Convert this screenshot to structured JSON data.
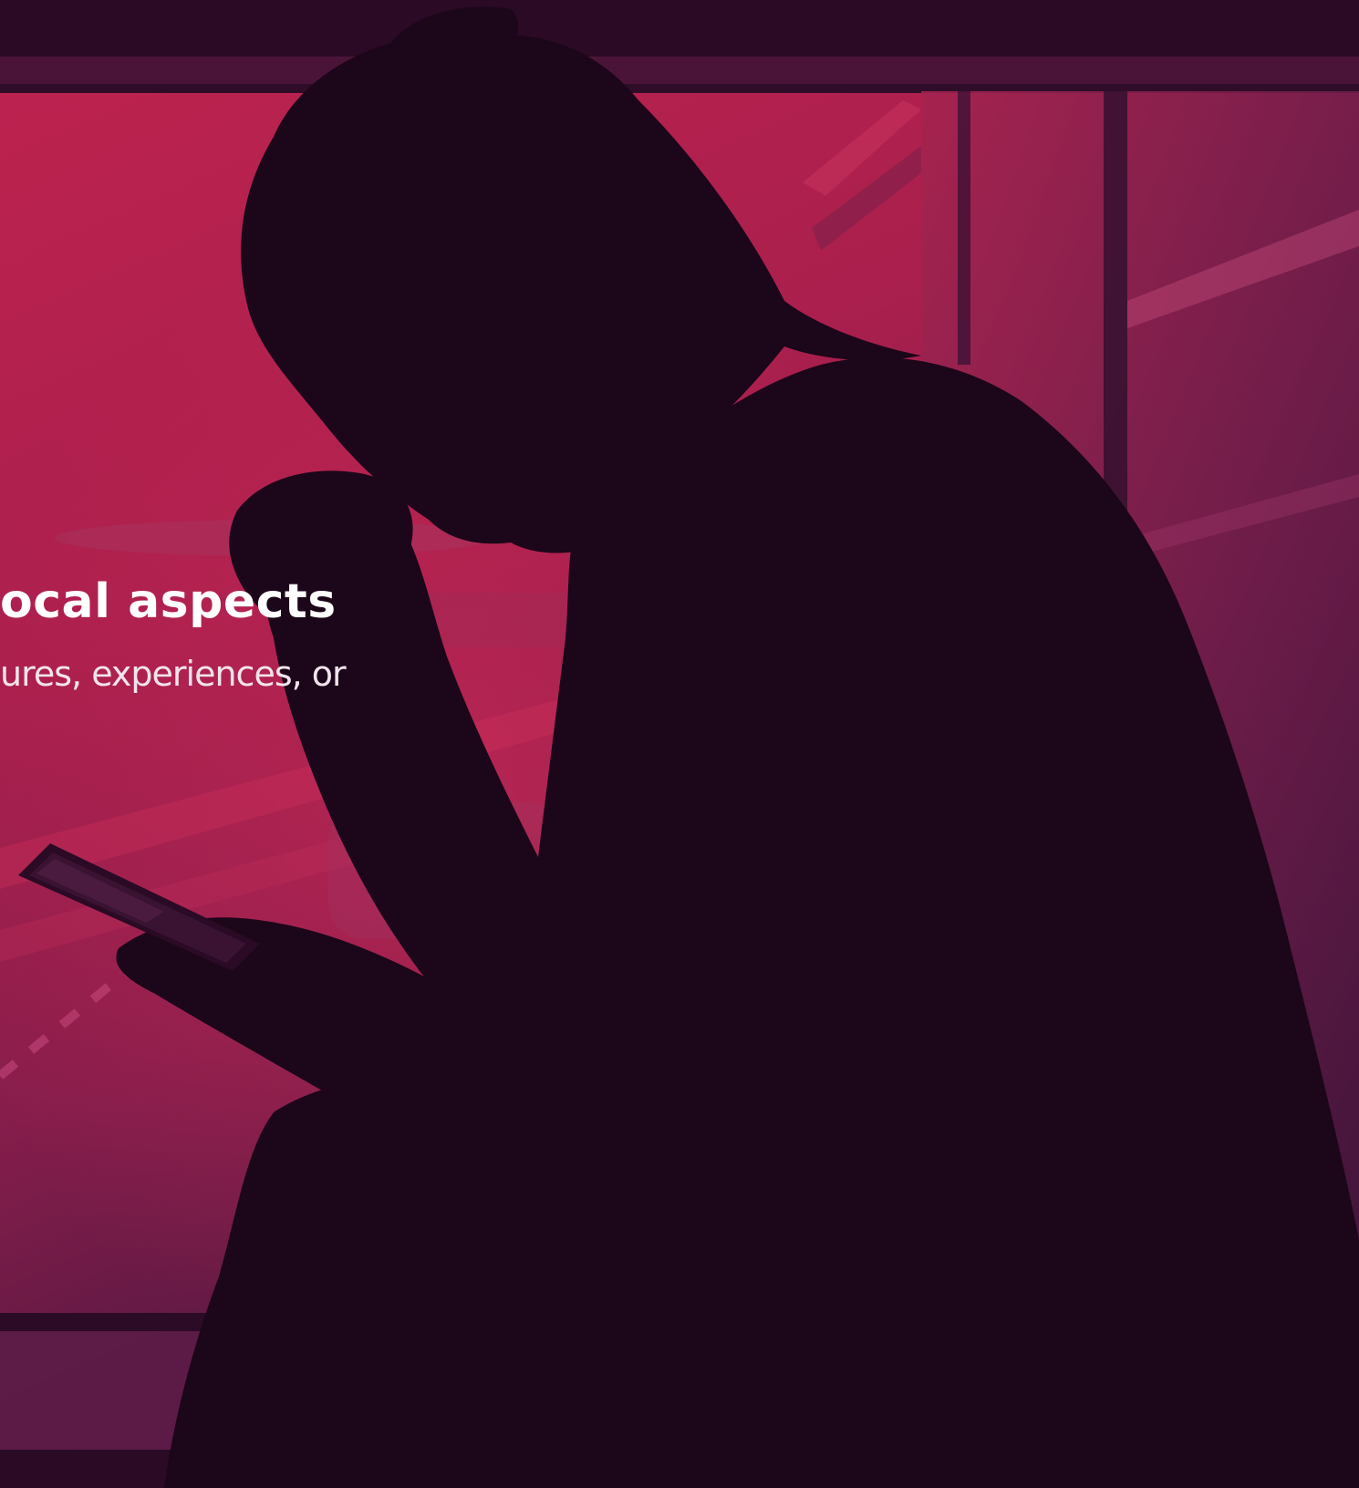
{
  "hero": {
    "headline": "ocal aspects",
    "subline": "ures, experiences, or"
  },
  "colors": {
    "overlay_top": "#b9224f",
    "overlay_bottom": "#3a1235",
    "silhouette": "#1a0616",
    "text": "#ffffff"
  }
}
